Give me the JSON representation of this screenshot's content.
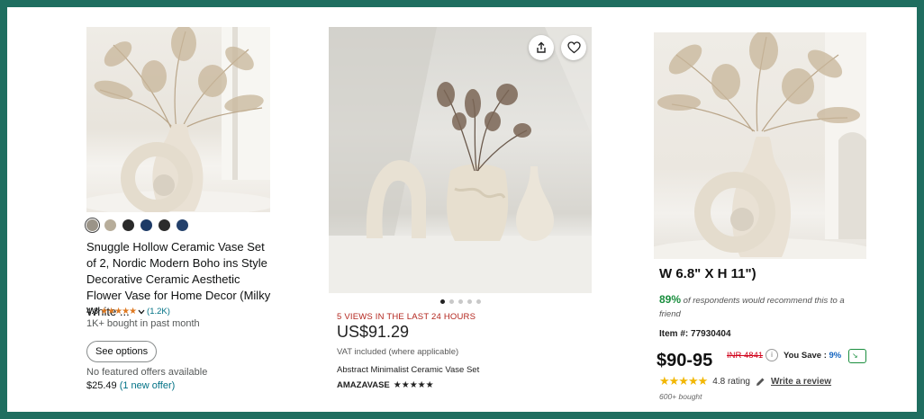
{
  "card1": {
    "swatch_colors": [
      "#9b9488",
      "#b7ad9a",
      "#2a2a2a",
      "#1c3a66",
      "#2b2b2b",
      "#23406b"
    ],
    "title": "Snuggle Hollow Ceramic Vase Set of 2, Nordic Modern Boho ins Style Decorative Ceramic Aesthetic Flower Vase for Home Decor (Milky White ...",
    "rating_value": "4.8",
    "stars": "★★★★★",
    "rating_count": "(1.2K)",
    "bought": "1K+ bought in past month",
    "see_options": "See options",
    "no_offers": "No featured offers available",
    "price": "$25.49",
    "offer_link": "(1 new offer)"
  },
  "card2": {
    "share_icon": "share-icon",
    "favorite_icon": "heart-icon",
    "views": "5 VIEWS IN THE LAST 24 HOURS",
    "price": "US$91.29",
    "vat": "VAT included (where applicable)",
    "title": "Abstract Minimalist Ceramic Vase Set",
    "shop": "AMAZAVASE",
    "shop_stars": "★★★★★",
    "carousel_total": 5,
    "carousel_active": 1
  },
  "card3": {
    "dims": "W 6.8\" X H 11\")",
    "recommend_pct": "89%",
    "recommend_text": " of respondents would recommend this to a friend",
    "item_no": "Item #: 77930404",
    "price": "$90-95",
    "inr": "INR 4841",
    "save_label": "You Save : ",
    "save_pct": "9%",
    "rating_stars": "★★★★★",
    "rating_text": "4.8 rating",
    "write_review": "Write a review",
    "sold": "600+ bought"
  }
}
